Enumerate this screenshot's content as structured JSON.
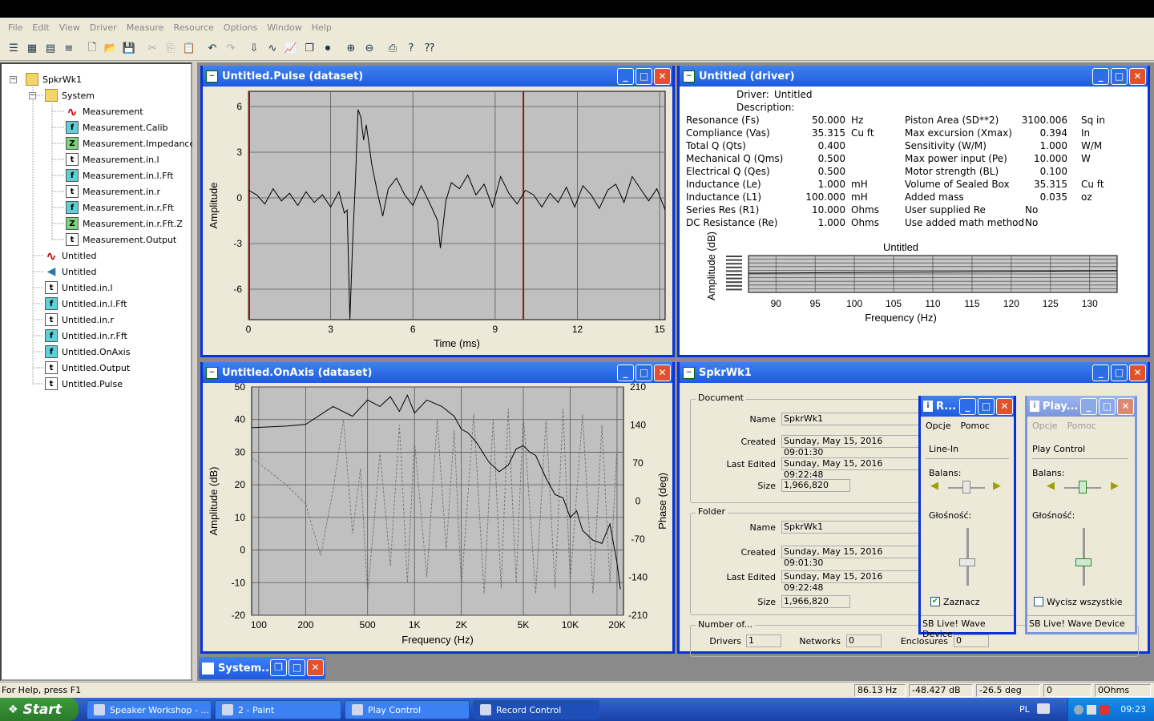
{
  "menu": [
    "File",
    "Edit",
    "View",
    "Driver",
    "Measure",
    "Resource",
    "Options",
    "Window",
    "Help"
  ],
  "toolbar_icons": [
    "tree-view-icon",
    "grid-view-icon",
    "table-view-icon",
    "list-view-icon",
    "new-file-icon",
    "open-folder-icon",
    "save-icon",
    "cut-icon",
    "copy-icon",
    "paste-icon",
    "undo-icon",
    "redo-icon",
    "import-icon",
    "waveform-icon",
    "chart-icon",
    "multi-window-icon",
    "record-icon",
    "zoom-in-icon",
    "zoom-out-icon",
    "print-icon",
    "help-icon",
    "context-help-icon"
  ],
  "tree": {
    "root": "SpkrWk1",
    "system": "System",
    "system_items": [
      {
        "label": "Measurement",
        "icon": "wave"
      },
      {
        "label": "Measurement.Calib",
        "icon": "f"
      },
      {
        "label": "Measurement.Impedance",
        "icon": "z"
      },
      {
        "label": "Measurement.in.l",
        "icon": "t"
      },
      {
        "label": "Measurement.in.l.Fft",
        "icon": "f"
      },
      {
        "label": "Measurement.in.r",
        "icon": "t"
      },
      {
        "label": "Measurement.in.r.Fft",
        "icon": "f"
      },
      {
        "label": "Measurement.in.r.Fft.Z",
        "icon": "z"
      },
      {
        "label": "Measurement.Output",
        "icon": "t"
      }
    ],
    "items": [
      {
        "label": "Untitled",
        "icon": "wave"
      },
      {
        "label": "Untitled",
        "icon": "spk"
      },
      {
        "label": "Untitled.in.l",
        "icon": "t"
      },
      {
        "label": "Untitled.in.l.Fft",
        "icon": "f"
      },
      {
        "label": "Untitled.in.r",
        "icon": "t"
      },
      {
        "label": "Untitled.in.r.Fft",
        "icon": "f"
      },
      {
        "label": "Untitled.OnAxis",
        "icon": "f"
      },
      {
        "label": "Untitled.Output",
        "icon": "t"
      },
      {
        "label": "Untitled.Pulse",
        "icon": "t"
      }
    ]
  },
  "pulse_window": {
    "title": "Untitled.Pulse (dataset)",
    "chart_data": {
      "type": "line",
      "xlabel": "Time (ms)",
      "ylabel": "Amplitude",
      "xlim": [
        0,
        15.2
      ],
      "ylim": [
        -8,
        7
      ],
      "xticks": [
        0,
        3,
        6,
        9,
        12,
        15
      ],
      "yticks": [
        6,
        3,
        0,
        -3,
        -6
      ],
      "markers_x": [
        0,
        10
      ],
      "series": [
        {
          "x": [
            0,
            0.3,
            0.6,
            0.9,
            1.2,
            1.5,
            1.8,
            2.1,
            2.4,
            2.7,
            3.0,
            3.3,
            3.5,
            3.6,
            3.7,
            3.8,
            3.9,
            4.0,
            4.1,
            4.2,
            4.3,
            4.5,
            4.7,
            4.9,
            5.1,
            5.4,
            5.7,
            6.0,
            6.3,
            6.6,
            6.9,
            7.0,
            7.1,
            7.2,
            7.4,
            7.7,
            8.0,
            8.3,
            8.6,
            8.9,
            9.2,
            9.5,
            9.8,
            10.1,
            10.4,
            10.7,
            11.0,
            11.3,
            11.6,
            11.9,
            12.2,
            12.5,
            12.8,
            13.1,
            13.4,
            13.7,
            14.0,
            14.3,
            14.6,
            14.9,
            15.2
          ],
          "y": [
            0.5,
            0.2,
            -0.4,
            0.6,
            -0.2,
            0.3,
            -0.5,
            0.4,
            -0.3,
            0.2,
            -0.6,
            0.4,
            -1.0,
            -0.8,
            -8.0,
            -3.0,
            1.0,
            5.8,
            5.3,
            3.8,
            4.8,
            2.2,
            0.4,
            -1.2,
            0.6,
            1.3,
            0.2,
            -0.5,
            0.8,
            -0.3,
            -1.5,
            -3.3,
            -1.8,
            -0.2,
            1.0,
            0.6,
            1.5,
            0.2,
            0.9,
            -0.6,
            1.4,
            0.3,
            -0.4,
            0.5,
            0.2,
            -0.6,
            0.3,
            -0.3,
            0.7,
            -0.6,
            0.8,
            0.2,
            -0.7,
            0.5,
            0.9,
            -0.3,
            1.4,
            0.6,
            -0.2,
            0.6,
            -0.8
          ]
        }
      ]
    }
  },
  "driver_window": {
    "title": "Untitled (driver)",
    "driver_label": "Driver:",
    "driver_value": "Untitled",
    "description_label": "Description:",
    "left_params": [
      {
        "name": "Resonance (Fs)",
        "value": "50.000",
        "unit": "Hz"
      },
      {
        "name": "Compliance (Vas)",
        "value": "35.315",
        "unit": "Cu ft"
      },
      {
        "name": "Total Q (Qts)",
        "value": "0.400",
        "unit": ""
      },
      {
        "name": "Mechanical Q (Qms)",
        "value": "0.500",
        "unit": ""
      },
      {
        "name": "Electrical Q (Qes)",
        "value": "0.500",
        "unit": ""
      },
      {
        "name": "Inductance (Le)",
        "value": "1.000",
        "unit": "mH"
      },
      {
        "name": "Inductance (L1)",
        "value": "100.000",
        "unit": "mH"
      },
      {
        "name": "Series Res (R1)",
        "value": "10.000",
        "unit": "Ohms"
      },
      {
        "name": "DC Resistance (Re)",
        "value": "1.000",
        "unit": "Ohms"
      }
    ],
    "right_params": [
      {
        "name": "Piston Area (SD**2)",
        "value": "3100.006",
        "unit": "Sq in"
      },
      {
        "name": "Max excursion (Xmax)",
        "value": "0.394",
        "unit": "In"
      },
      {
        "name": "Sensitivity (W/M)",
        "value": "1.000",
        "unit": "W/M"
      },
      {
        "name": "Max power input (Pe)",
        "value": "10.000",
        "unit": "W"
      },
      {
        "name": "Motor strength (BL)",
        "value": "0.100",
        "unit": ""
      },
      {
        "name": "Volume of Sealed Box",
        "value": "35.315",
        "unit": "Cu ft"
      },
      {
        "name": "Added mass",
        "value": "0.035",
        "unit": "oz"
      },
      {
        "name": "User supplied Re",
        "value": "No",
        "unit": ""
      },
      {
        "name": "Use added math method",
        "value": "No",
        "unit": ""
      }
    ],
    "chart_data": {
      "type": "line",
      "title": "Untitled",
      "xlabel": "Frequency (Hz)",
      "ylabel": "Amplitude (dB)",
      "xlim": [
        86.5,
        133.5
      ],
      "xticks": [
        90,
        95,
        100,
        105,
        110,
        115,
        120,
        125,
        130
      ],
      "series": [
        {
          "x": [
            86.5,
            133.5
          ],
          "y": [
            0,
            0
          ]
        }
      ]
    }
  },
  "onaxis_window": {
    "title": "Untitled.OnAxis (dataset)",
    "chart_data": {
      "type": "line",
      "xlabel": "Frequency (Hz)",
      "ylabel": "Amplitude (dB)",
      "ylabel2": "Phase (deg)",
      "xscale": "log",
      "xlim": [
        90,
        22000
      ],
      "ylim": [
        -20,
        50
      ],
      "y2lim": [
        -210,
        210
      ],
      "xticks": [
        {
          "v": 100,
          "l": "100"
        },
        {
          "v": 200,
          "l": "200"
        },
        {
          "v": 500,
          "l": "500"
        },
        {
          "v": 1000,
          "l": "1K"
        },
        {
          "v": 2000,
          "l": "2K"
        },
        {
          "v": 5000,
          "l": "5K"
        },
        {
          "v": 10000,
          "l": "10K"
        },
        {
          "v": 20000,
          "l": "20K"
        }
      ],
      "yticks": [
        50,
        40,
        30,
        20,
        10,
        0,
        -10,
        -20
      ],
      "y2ticks": [
        210,
        140,
        70,
        0,
        -70,
        -140,
        -210
      ],
      "series": [
        {
          "x": [
            90,
            150,
            200,
            300,
            400,
            500,
            600,
            700,
            800,
            900,
            1000,
            1200,
            1500,
            1800,
            2000,
            2200,
            2500,
            3000,
            3500,
            4000,
            4500,
            5000,
            5500,
            6000,
            7000,
            8000,
            9000,
            10000,
            11000,
            12000,
            14000,
            16000,
            18000,
            20000,
            21000
          ],
          "y": [
            37.5,
            38,
            38.5,
            44,
            41,
            46,
            44,
            47,
            42.5,
            47.5,
            42,
            46,
            44,
            41,
            37,
            36,
            33,
            27,
            24,
            26,
            31,
            32,
            30,
            29,
            22,
            17,
            16,
            10,
            12,
            6,
            3,
            2,
            8,
            -4,
            -12
          ]
        },
        {
          "x": [
            90,
            150,
            200,
            250,
            300,
            350,
            400,
            450,
            500,
            550,
            600,
            700,
            800,
            900,
            1000,
            1200,
            1400,
            1600,
            1800,
            2000,
            2400,
            2800,
            3200,
            3600,
            4000,
            4500,
            5000,
            6000,
            7000,
            8000,
            9000,
            10000,
            12000,
            14000,
            16000,
            18000,
            20000
          ],
          "y": [
            80,
            30,
            -5,
            -100,
            20,
            150,
            -60,
            60,
            -170,
            -40,
            90,
            -120,
            140,
            -150,
            110,
            -140,
            150,
            -90,
            130,
            -160,
            160,
            -170,
            150,
            -160,
            170,
            -150,
            160,
            -170,
            150,
            -160,
            170,
            -150,
            160,
            -170,
            140,
            -150,
            100
          ]
        }
      ]
    }
  },
  "props_window": {
    "title": "SpkrWk1",
    "document_group": "Document",
    "folder_group": "Folder",
    "number_group": "Number of...",
    "name_label": "Name",
    "created_label": "Created",
    "modified_label": "Last Edited",
    "size_label": "Size",
    "doc_name": "SpkrWk1",
    "doc_created": "Sunday, May 15, 2016 09:01:30",
    "doc_modified": "Sunday, May 15, 2016 09:22:48",
    "doc_size": "1,966,820",
    "folder_name": "SpkrWk1",
    "folder_created": "Sunday, May 15, 2016 09:01:30",
    "folder_modified": "Sunday, May 15, 2016 09:22:48",
    "folder_size": "1,966,820",
    "drivers_label": "Drivers",
    "drivers_value": "1",
    "networks_label": "Networks",
    "networks_value": "0",
    "enclosures_label": "Enclosures",
    "enclosures_value": "0"
  },
  "record_mixer": {
    "title": "R...",
    "menu": [
      "Opcje",
      "Pomoc"
    ],
    "section": "Line-In",
    "balance_label": "Balans:",
    "volume_label": "Głośność:",
    "balance": 0.5,
    "volume": 0.4,
    "checkbox_label": "Zaznacz",
    "checked": true,
    "device": "SB Live! Wave Device"
  },
  "play_mixer": {
    "title": "Play...",
    "menu": [
      "Opcje",
      "Pomoc"
    ],
    "section": "Play Control",
    "balance_label": "Balans:",
    "volume_label": "Głośność:",
    "balance": 0.5,
    "volume": 0.4,
    "checkbox_label": "Wycisz wszystkie",
    "checked": false,
    "device": "SB Live! Wave Device"
  },
  "minimized": {
    "title": "System..."
  },
  "status": {
    "help": "For Help, press F1",
    "freq": "86.13 Hz",
    "db": "-48.427 dB",
    "deg": "-26.5 deg",
    "zero": "0",
    "ohms": "0Ohms"
  },
  "taskbar": {
    "start": "Start",
    "tasks": [
      "Speaker Workshop - ...",
      "2 - Paint",
      "Play Control",
      "Record Control"
    ],
    "lang": "PL",
    "clock": "09:23"
  }
}
